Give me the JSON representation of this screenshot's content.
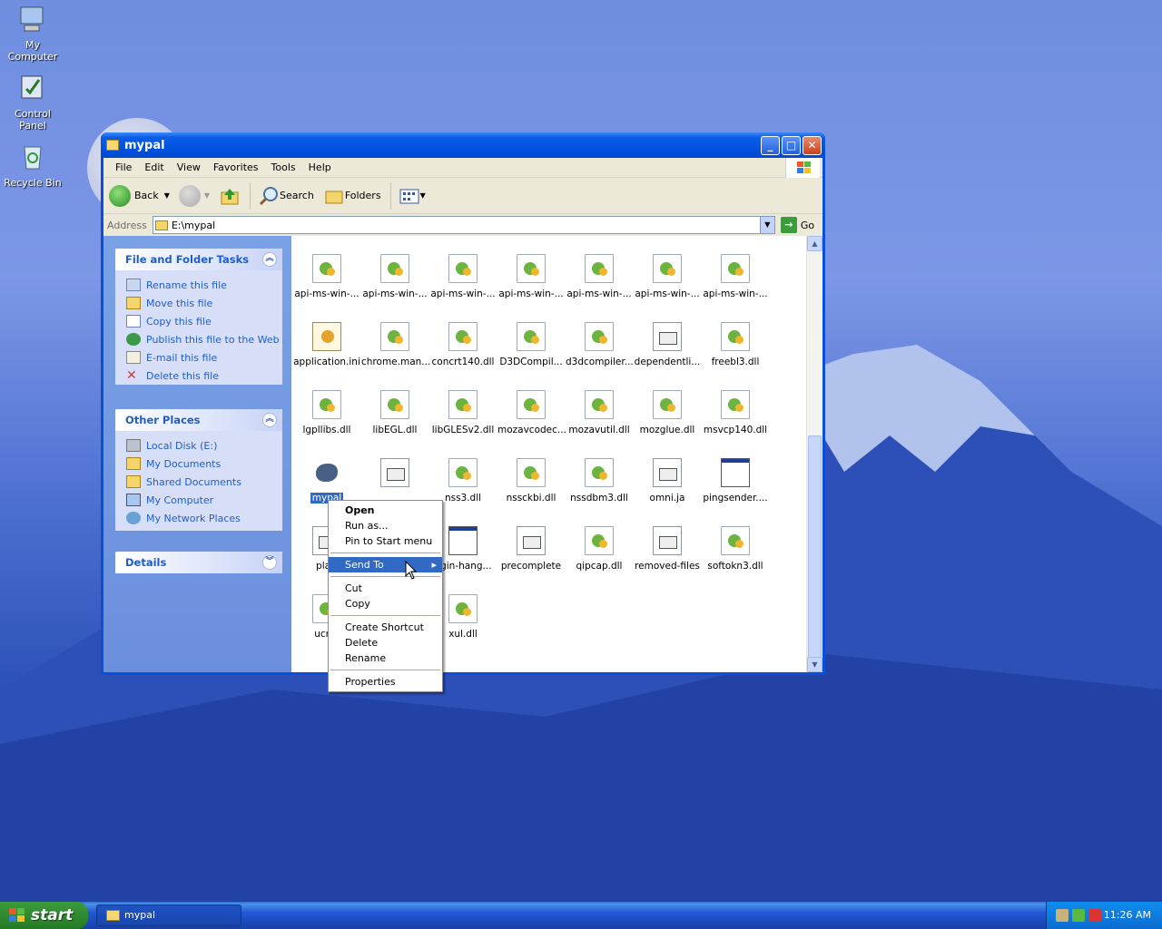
{
  "desktop": {
    "icons": [
      {
        "label": "My Computer"
      },
      {
        "label": "Control Panel"
      },
      {
        "label": "Recycle Bin"
      }
    ]
  },
  "window": {
    "title": "mypal",
    "menu": [
      "File",
      "Edit",
      "View",
      "Favorites",
      "Tools",
      "Help"
    ],
    "toolbar": {
      "back": "Back",
      "search": "Search",
      "folders": "Folders"
    },
    "address": {
      "label": "Address",
      "value": "E:\\mypal",
      "go": "Go"
    }
  },
  "tasks_panel": {
    "title": "File and Folder Tasks",
    "items": [
      "Rename this file",
      "Move this file",
      "Copy this file",
      "Publish this file to the Web",
      "E-mail this file",
      "Delete this file"
    ]
  },
  "places_panel": {
    "title": "Other Places",
    "items": [
      "Local Disk (E:)",
      "My Documents",
      "Shared Documents",
      "My Computer",
      "My Network Places"
    ]
  },
  "details_panel": {
    "title": "Details"
  },
  "files": [
    {
      "name": "api-ms-win-...",
      "icon": "dll"
    },
    {
      "name": "api-ms-win-...",
      "icon": "dll"
    },
    {
      "name": "api-ms-win-...",
      "icon": "dll"
    },
    {
      "name": "api-ms-win-...",
      "icon": "dll"
    },
    {
      "name": "api-ms-win-...",
      "icon": "dll"
    },
    {
      "name": "api-ms-win-...",
      "icon": "dll"
    },
    {
      "name": "api-ms-win-...",
      "icon": "dll"
    },
    {
      "name": "api-ms-win-...",
      "icon": "dll"
    },
    {
      "name": "api-ms-win-...",
      "icon": "dll"
    },
    {
      "name": "api-ms-win-...",
      "icon": "dll"
    },
    {
      "name": "api-ms-win-...",
      "icon": "dll"
    },
    {
      "name": "api-ms-win-...",
      "icon": "dll"
    },
    {
      "name": "api-ms-win-...",
      "icon": "dll"
    },
    {
      "name": "api-ms-win-...",
      "icon": "dll"
    },
    {
      "name": "application.ini",
      "icon": "ini"
    },
    {
      "name": "chrome.man...",
      "icon": "dll"
    },
    {
      "name": "concrt140.dll",
      "icon": "dll"
    },
    {
      "name": "D3DCompil...",
      "icon": "dll"
    },
    {
      "name": "d3dcompiler...",
      "icon": "dll"
    },
    {
      "name": "dependentli...",
      "icon": "doc"
    },
    {
      "name": "freebl3.dll",
      "icon": "dll"
    },
    {
      "name": "lgpllibs.dll",
      "icon": "dll"
    },
    {
      "name": "libEGL.dll",
      "icon": "dll"
    },
    {
      "name": "libGLESv2.dll",
      "icon": "dll"
    },
    {
      "name": "mozavcodec...",
      "icon": "dll"
    },
    {
      "name": "mozavutil.dll",
      "icon": "dll"
    },
    {
      "name": "mozglue.dll",
      "icon": "dll"
    },
    {
      "name": "msvcp140.dll",
      "icon": "dll"
    },
    {
      "name": "mypal",
      "icon": "pal"
    },
    {
      "name": "",
      "icon": "doc"
    },
    {
      "name": "nss3.dll",
      "icon": "dll"
    },
    {
      "name": "nssckbi.dll",
      "icon": "dll"
    },
    {
      "name": "nssdbm3.dll",
      "icon": "dll"
    },
    {
      "name": "omni.ja",
      "icon": "doc"
    },
    {
      "name": "pingsender....",
      "icon": "win"
    },
    {
      "name": "platf",
      "icon": "doc"
    },
    {
      "name": "",
      "icon": "none"
    },
    {
      "name": "ugin-hang...",
      "icon": "win"
    },
    {
      "name": "precomplete",
      "icon": "doc"
    },
    {
      "name": "qipcap.dll",
      "icon": "dll"
    },
    {
      "name": "removed-files",
      "icon": "doc"
    },
    {
      "name": "softokn3.dll",
      "icon": "dll"
    },
    {
      "name": "ucrtb",
      "icon": "dll"
    },
    {
      "name": "",
      "icon": "none"
    },
    {
      "name": "xul.dll",
      "icon": "dll"
    }
  ],
  "context_menu": {
    "items": [
      "Open",
      "Run as...",
      "Pin to Start menu",
      "Send To",
      "Cut",
      "Copy",
      "Create Shortcut",
      "Delete",
      "Rename",
      "Properties"
    ]
  },
  "taskbar": {
    "start": "start",
    "task": "mypal",
    "clock": "11:26 AM"
  }
}
